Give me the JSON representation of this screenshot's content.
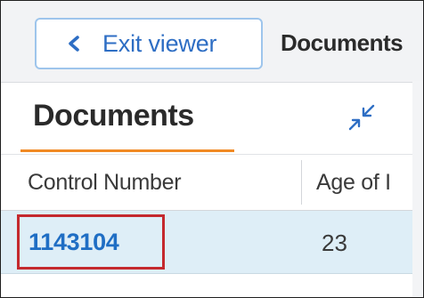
{
  "toolbar": {
    "exit_label": "Exit viewer",
    "breadcrumb": "Documents"
  },
  "panel": {
    "tab_title": "Documents",
    "accent_color": "#f08a24"
  },
  "grid": {
    "columns": [
      "Control Number",
      "Age of I"
    ],
    "rows": [
      {
        "control_number": "1143104",
        "age": "23"
      }
    ]
  },
  "icons": {
    "exit": "chevron-left-icon",
    "collapse": "collapse-arrows-icon"
  },
  "colors": {
    "link": "#1f6ec4",
    "highlight_box": "#c4292e",
    "row_selected": "#deeef7"
  }
}
